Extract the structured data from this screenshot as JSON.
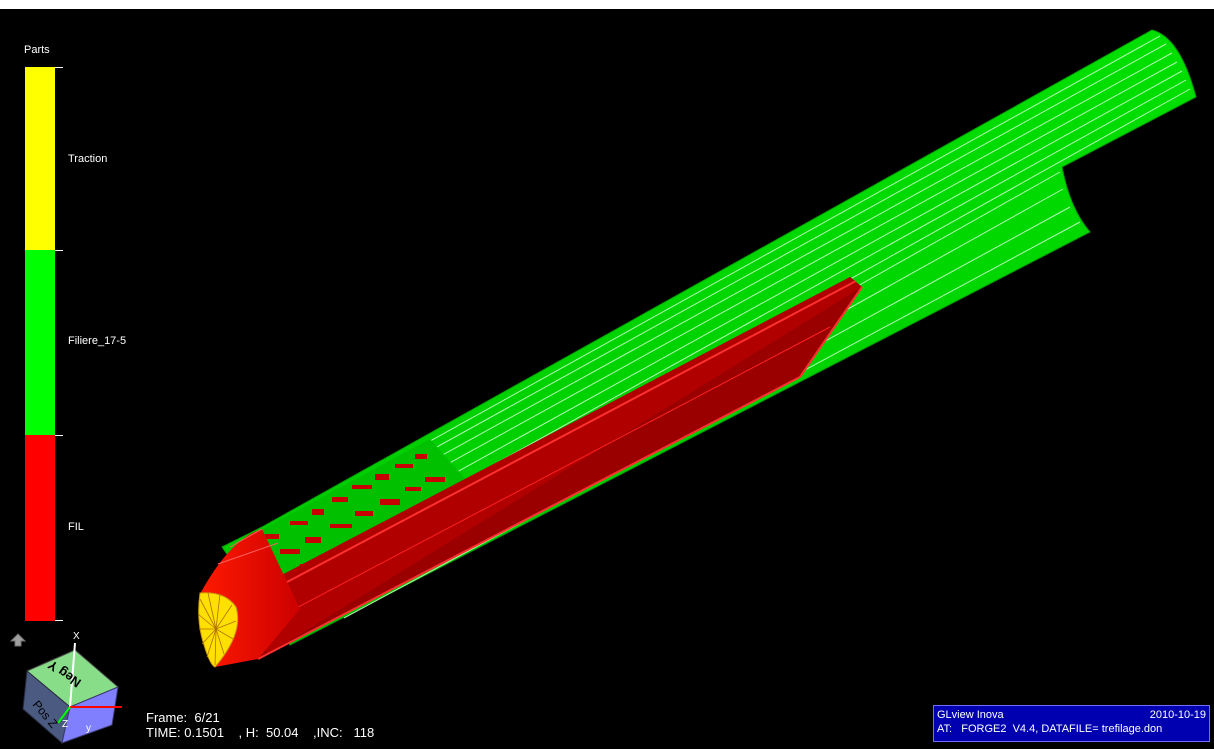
{
  "legend": {
    "title": "Parts",
    "items": [
      {
        "label": "Traction",
        "color": "#ffff00"
      },
      {
        "label": "Filiere_17-5",
        "color": "#00ff00"
      },
      {
        "label": "FIL",
        "color": "#ff0000"
      }
    ]
  },
  "orientation_cube": {
    "top_face": "Neg Y",
    "left_face": "Pos Z",
    "axis_x": "X",
    "axis_z": "Z",
    "axis_y": "y"
  },
  "frame": {
    "frame_line": "Frame:  6/21",
    "time_label": "TIME:",
    "time_value": "0.1501",
    "h_label": ", H:",
    "h_value": "50.04",
    "inc_label": ",INC:",
    "inc_value": "118"
  },
  "info": {
    "product": "GLview Inova",
    "date": "2010-10-19",
    "at_line": "AT:   FORGE2  V4.4, DATAFILE= trefilage.don"
  },
  "icons": {
    "home": "home-arrow-icon"
  }
}
